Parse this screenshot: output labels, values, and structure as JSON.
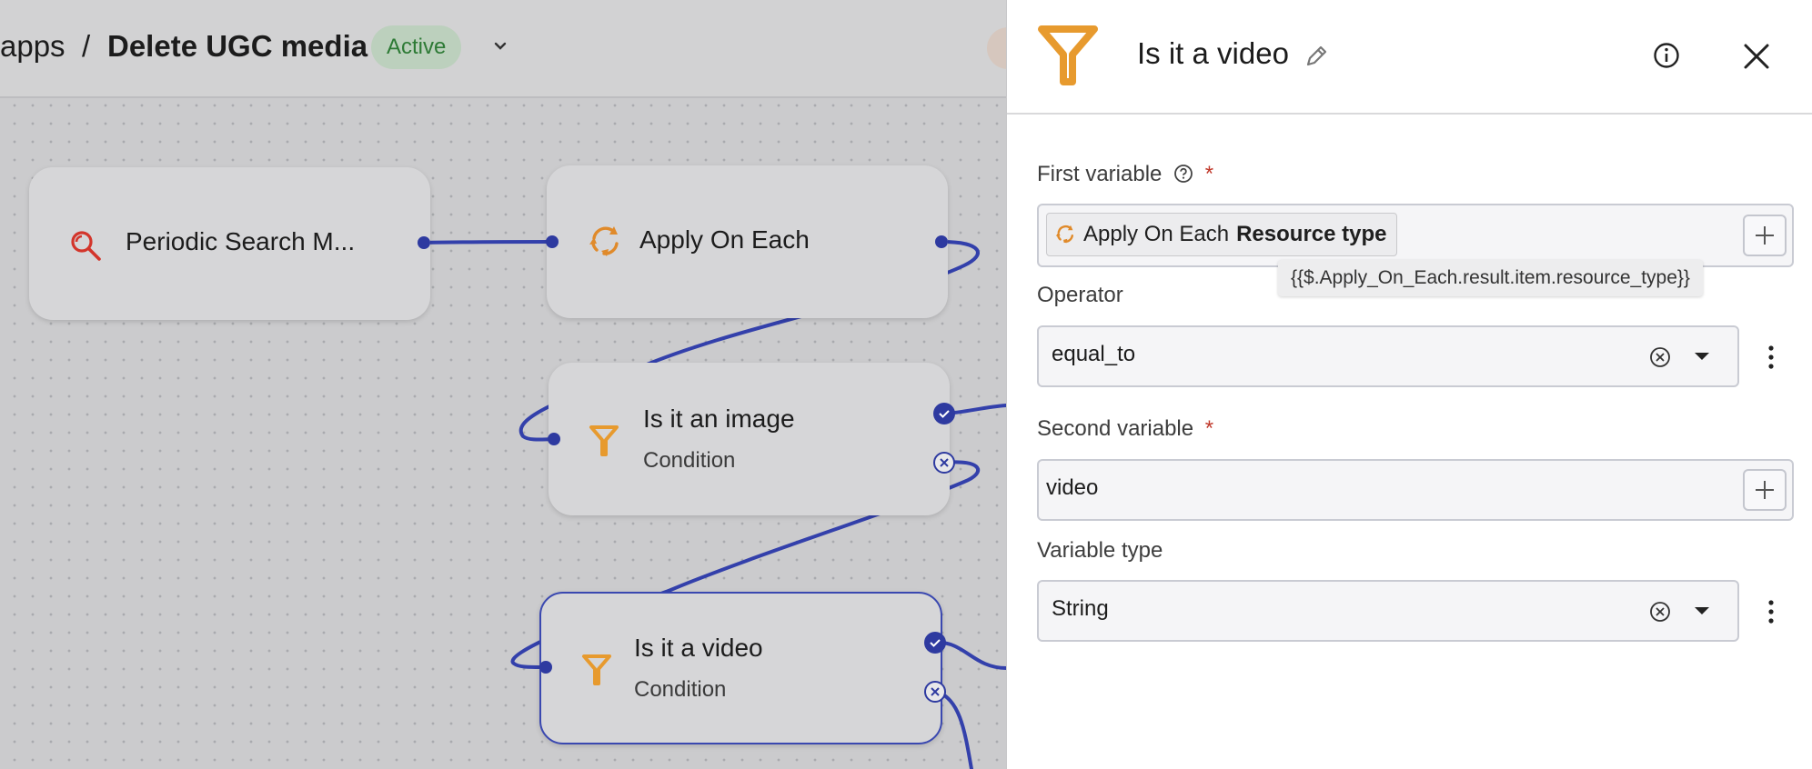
{
  "breadcrumb": {
    "parent": "apps",
    "separator": "/",
    "title": "Delete UGC media",
    "status": "Active"
  },
  "nodes": [
    {
      "title": "Periodic Search M...",
      "icon": "magnify-search-icon"
    },
    {
      "title": "Apply On Each",
      "icon": "loop-arrows-icon"
    },
    {
      "title": "Is it an image",
      "subtitle": "Condition",
      "icon": "filter-funnel-icon"
    },
    {
      "title": "Is it a video",
      "subtitle": "Condition",
      "icon": "filter-funnel-icon"
    }
  ],
  "panel": {
    "title": "Is it a video",
    "first_variable": {
      "label": "First variable",
      "chip_source": "Apply On Each",
      "chip_field": "Resource type",
      "tooltip": "{{$.Apply_On_Each.result.item.resource_type}}"
    },
    "operator": {
      "label": "Operator",
      "value": "equal_to"
    },
    "second_variable": {
      "label": "Second variable",
      "value": "video"
    },
    "variable_type": {
      "label": "Variable type",
      "value": "String"
    },
    "required_marker": "*"
  },
  "colors": {
    "accent": "#2e3aa0",
    "filter_orange": "#e79a2e",
    "search_red": "#d3352b",
    "badge_bg": "#bcd0bd",
    "badge_text": "#2d7a35"
  }
}
